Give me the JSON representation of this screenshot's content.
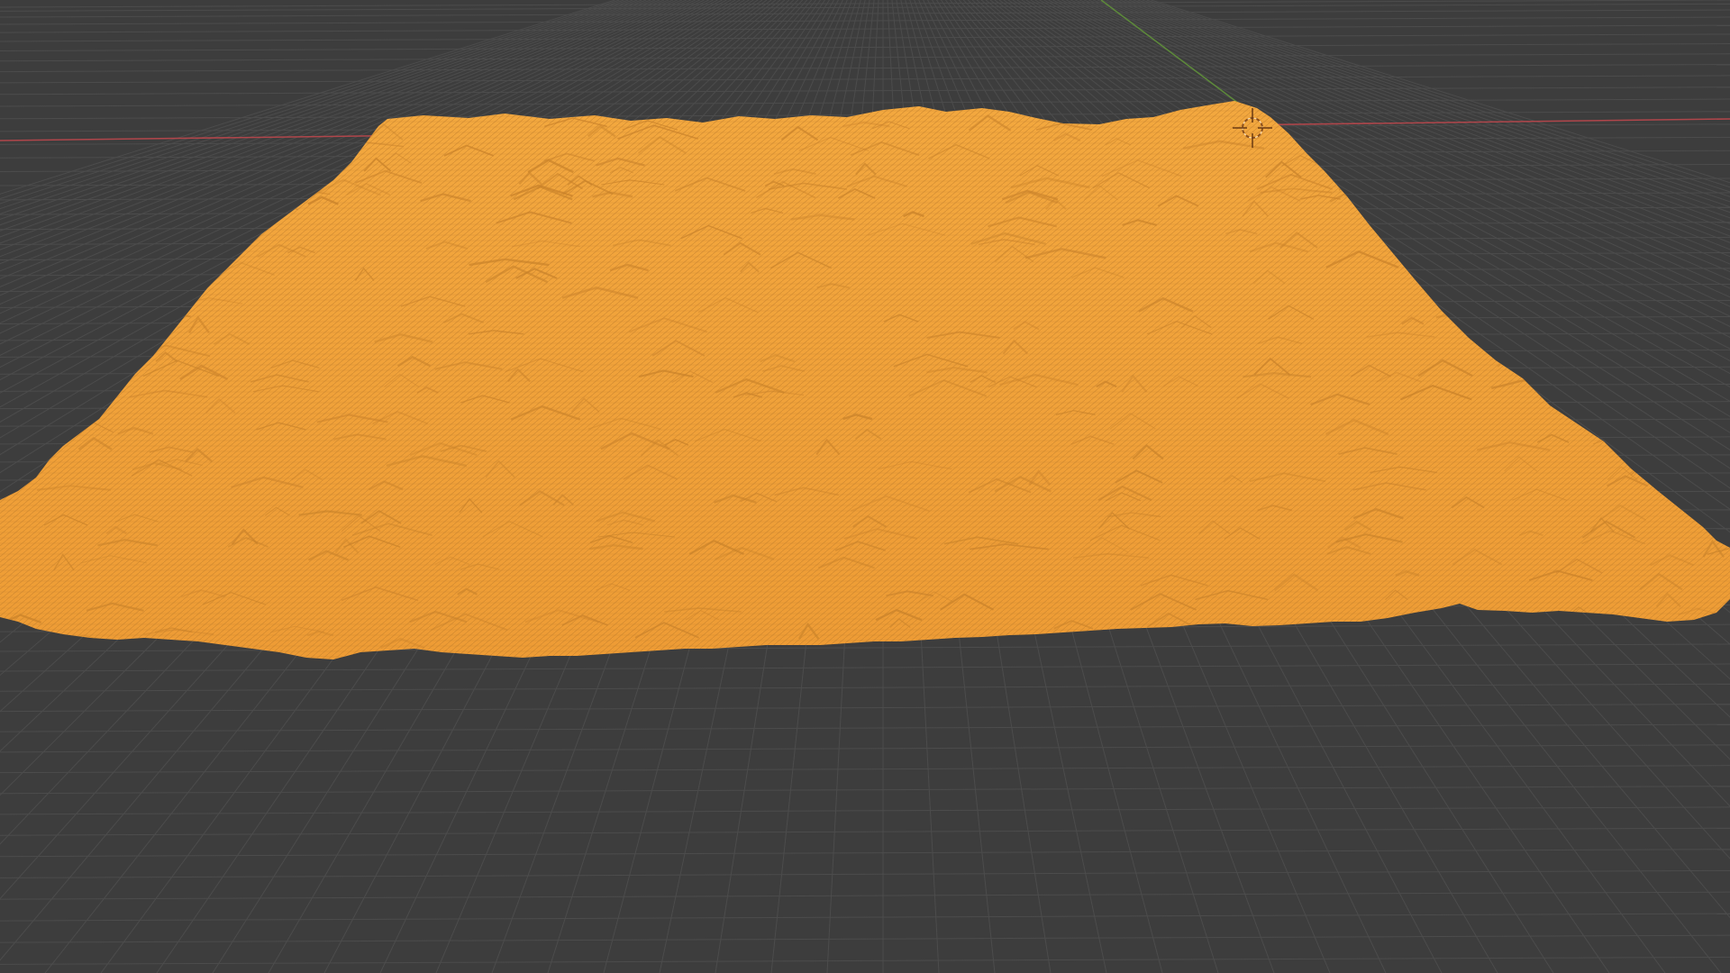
{
  "viewport": {
    "background_color": "#3d3d3d",
    "grid_color": "#4c4c4c",
    "grid_minor_color": "#454545",
    "axis_x_color": "#b0464b",
    "axis_y_color": "#5d8a3a"
  },
  "terrain_mesh": {
    "color": "#f0a03a",
    "shade_color": "#c9822a",
    "wire_color": "#b8782a",
    "selected": true
  },
  "cursor_3d": {
    "icon": "3d-cursor-icon"
  }
}
